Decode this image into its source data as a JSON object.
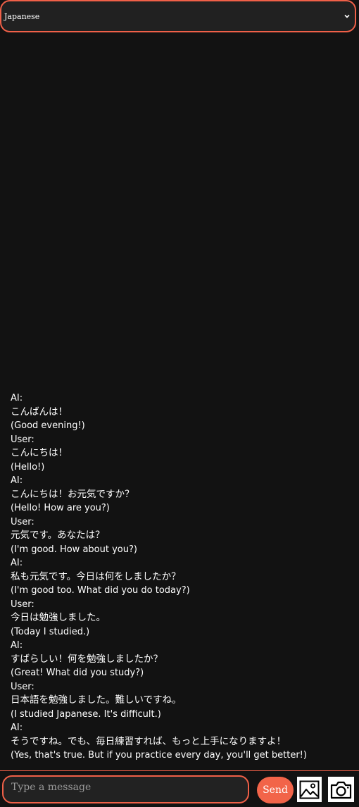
{
  "language_select": {
    "value": "Japanese"
  },
  "messages": [
    {
      "speaker": "AI:",
      "text": "こんばんは！",
      "translation": "(Good evening!)"
    },
    {
      "speaker": "User:",
      "text": "こんにちは！",
      "translation": "(Hello!)"
    },
    {
      "speaker": "AI:",
      "text": "こんにちは！お元気ですか？",
      "translation": "(Hello! How are you?)"
    },
    {
      "speaker": "User:",
      "text": "元気です。あなたは？",
      "translation": "(I'm good. How about you?)"
    },
    {
      "speaker": "AI:",
      "text": "私も元気です。今日は何をしましたか？",
      "translation": "(I'm good too. What did you do today?)"
    },
    {
      "speaker": "User:",
      "text": "今日は勉強しました。",
      "translation": "(Today I studied.)"
    },
    {
      "speaker": "AI:",
      "text": "すばらしい！何を勉強しましたか？",
      "translation": "(Great! What did you study?)"
    },
    {
      "speaker": "User:",
      "text": "日本語を勉強しました。難しいですね。",
      "translation": "(I studied Japanese. It's difficult.)"
    },
    {
      "speaker": "AI:",
      "text": "そうですね。でも、毎日練習すれば、もっと上手になりますよ！",
      "translation": "(Yes, that's true. But if you practice every day, you'll get better!)"
    }
  ],
  "composer": {
    "placeholder": "Type a message",
    "send_label": "Send",
    "image_icon": "image-icon",
    "camera_icon": "camera-icon"
  },
  "colors": {
    "background": "#121212",
    "accent": "#f26449",
    "text": "#ffffff",
    "field_background": "#222222"
  }
}
